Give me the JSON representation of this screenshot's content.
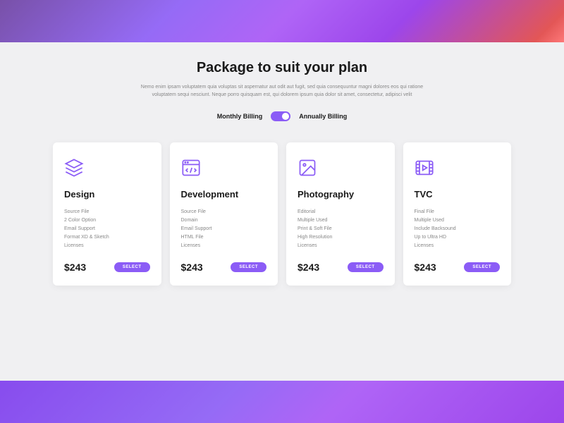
{
  "header": {
    "title": "Package to suit your plan",
    "subtitle": "Nemo enim ipsam voluptatem quia voluptas sit aspernatur aut odit aut fugit, sed quia consequuntur magni dolores eos qui ratione voluptatem sequi nesciunt. Neque porro quisquam est, qui dolorem ipsum quia dolor sit amet, consectetur, adipisci velit"
  },
  "billing": {
    "monthly": "Monthly Billing",
    "annually": "Annually Billing"
  },
  "plans": [
    {
      "title": "Design",
      "features": [
        "Source File",
        "2 Color Option",
        "Email Support",
        "Format XD & Sketch",
        "Licenses"
      ],
      "price": "$243",
      "button": "SELECT"
    },
    {
      "title": "Development",
      "features": [
        "Source File",
        "Domain",
        "Email Support",
        "HTML File",
        "Licenses"
      ],
      "price": "$243",
      "button": "SELECT"
    },
    {
      "title": "Photography",
      "features": [
        "Editorial",
        "Multiple Used",
        "Print & Soft File",
        "High Resolution",
        "Licenses"
      ],
      "price": "$243",
      "button": "SELECT"
    },
    {
      "title": "TVC",
      "features": [
        "Final File",
        "Multiple Used",
        "Include Backsound",
        "Up to Ultra HD",
        "Licenses"
      ],
      "price": "$243",
      "button": "SELECT"
    }
  ]
}
